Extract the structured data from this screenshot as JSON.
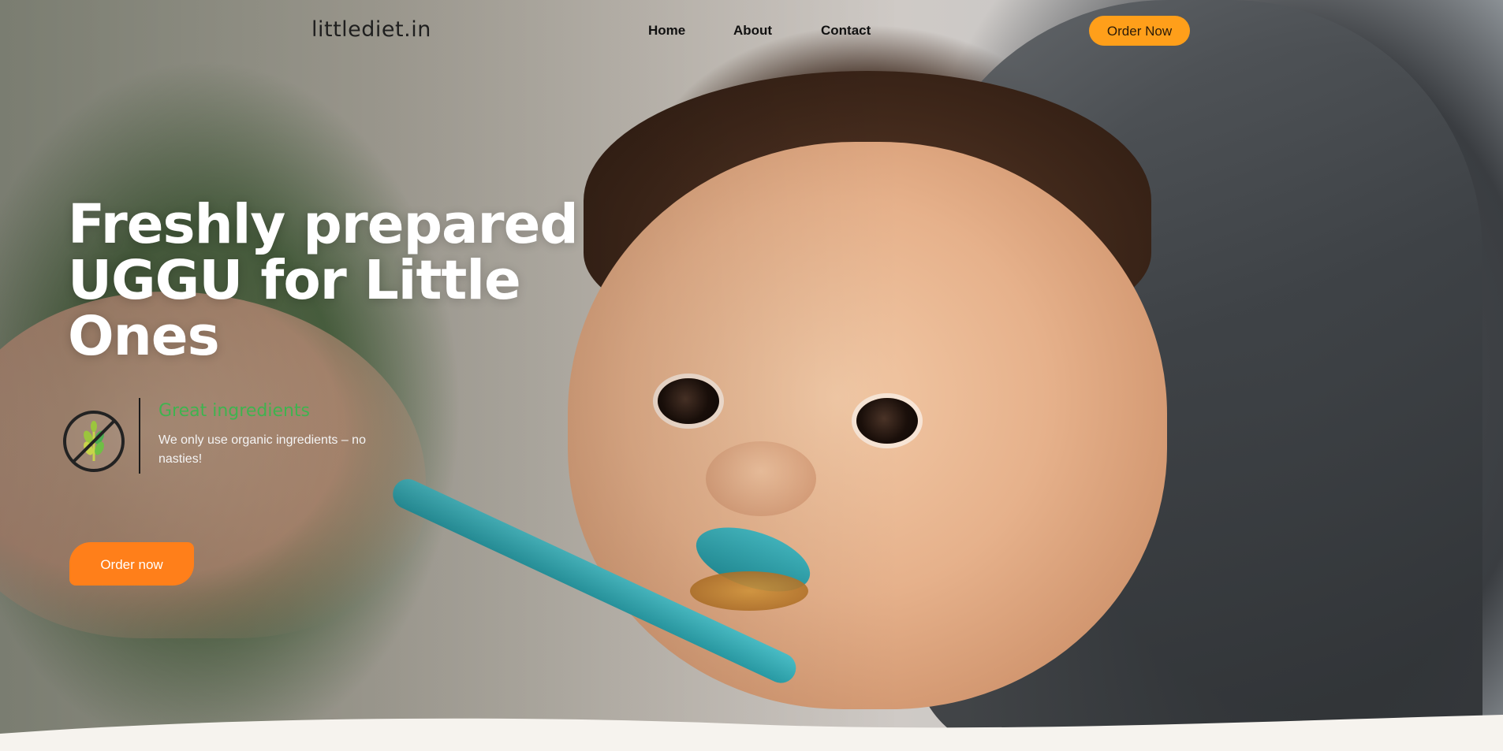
{
  "nav": {
    "logo": "littlediet.in",
    "links": [
      {
        "label": "Home"
      },
      {
        "label": "About"
      },
      {
        "label": "Contact"
      }
    ],
    "order_label": "Order Now"
  },
  "hero": {
    "headline_lines": [
      "Freshly prepared",
      "UGGU for Little",
      "Ones"
    ],
    "feature": {
      "icon": "no-gluten-wheat-icon",
      "title": "Great ingredients",
      "text": "We only use organic ingredients – no nasties!"
    },
    "cta_label": "Order now"
  },
  "colors": {
    "nav_button": "#ff9f1a",
    "cta_button": "#ff7f1a",
    "feature_title": "#3fb34f",
    "headline": "#ffffff",
    "section_below": "#f6f3ee"
  }
}
